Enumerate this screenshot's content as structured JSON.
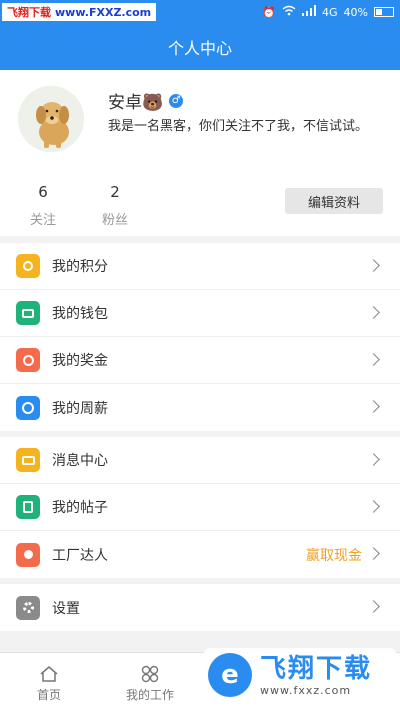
{
  "status_bar": {
    "watermark_left": "飞翔下载",
    "watermark_right": "www.FXXZ.com",
    "network": "4G",
    "battery": "40%"
  },
  "header": {
    "title": "个人中心"
  },
  "profile": {
    "name": "安卓🐻",
    "gender_symbol": "♂",
    "bio": "我是一名黑客，你们关注不了我，不信试试。",
    "following_count": "6",
    "following_label": "关注",
    "followers_count": "2",
    "followers_label": "粉丝",
    "edit_label": "编辑资料"
  },
  "menu_groups": [
    {
      "items": [
        {
          "label": "我的积分",
          "icon": "points-icon",
          "color": "#f5b320"
        },
        {
          "label": "我的钱包",
          "icon": "wallet-icon",
          "color": "#1fb37a"
        },
        {
          "label": "我的奖金",
          "icon": "bonus-icon",
          "color": "#f36b4a"
        },
        {
          "label": "我的周薪",
          "icon": "clock-icon",
          "color": "#2b8cf0"
        }
      ]
    },
    {
      "items": [
        {
          "label": "消息中心",
          "icon": "message-icon",
          "color": "#f5b320"
        },
        {
          "label": "我的帖子",
          "icon": "post-icon",
          "color": "#1fb37a"
        },
        {
          "label": "工厂达人",
          "icon": "expert-icon",
          "color": "#f36b4a",
          "extra": "赢取现金"
        }
      ]
    },
    {
      "items": [
        {
          "label": "设置",
          "icon": "settings-icon",
          "color": "#8a8a8a"
        }
      ]
    }
  ],
  "tabs": [
    {
      "label": "首页",
      "icon": "home-icon"
    },
    {
      "label": "我的工作",
      "icon": "work-icon"
    }
  ],
  "brand_overlay": {
    "main": "飞翔下载",
    "url": "www.fxxz.com"
  }
}
